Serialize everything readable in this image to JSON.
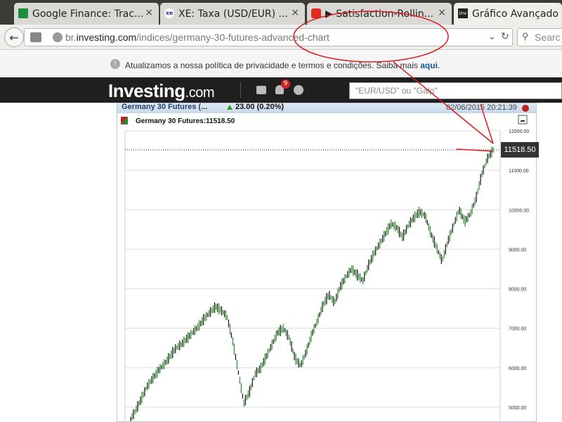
{
  "tabs": [
    {
      "title": "Google Finance: Trac...",
      "close": "×"
    },
    {
      "title": "XE: Taxa (USD/EUR) ...",
      "close": "×"
    },
    {
      "title": "▶ Satisfaction-Rollin...",
      "close": "×"
    },
    {
      "title": "Gráfico Avançado e",
      "close": ""
    }
  ],
  "nav": {
    "url_host_prefix": "br.",
    "url_host_main": "investing.com",
    "url_path": "/indices/germany-30-futures-advanced-chart",
    "search_placeholder": "Searc"
  },
  "notice": {
    "text": "Atualizamos a nossa política de privacidade e termos e condições. Saiba mais",
    "link": "aqui",
    "end": "."
  },
  "header": {
    "logo_main": "Investing",
    "logo_suffix": ".com",
    "notification_count": "9",
    "search_placeholder": "\"EUR/USD\" ou \"Galp\""
  },
  "chart_header": {
    "instrument": "Germany 30 Futures (...",
    "change": "23.00 (0.20%)",
    "datetime": "02/06/2015 20:21:39"
  },
  "chart": {
    "legend": "Germany 30 Futures:11518.50",
    "current_price": "11518.50"
  },
  "chart_data": {
    "type": "line",
    "title": "",
    "xlabel": "",
    "ylabel": "",
    "ylim": [
      4700,
      12200
    ],
    "y_ticks": [
      "12000.00",
      "11000.00",
      "10000.00",
      "9000.00",
      "8000.00",
      "7000.00",
      "6000.00",
      "5000.00"
    ],
    "y_tick_values": [
      12000,
      11000,
      10000,
      9000,
      8000,
      7000,
      6000,
      5000
    ],
    "current_value": 11518.5,
    "series": [
      {
        "values": [
          4700,
          4950,
          5250,
          5550,
          5750,
          5950,
          6100,
          6300,
          6500,
          6600,
          6750,
          6900,
          7050,
          7250,
          7400,
          7550,
          7450,
          7300,
          6700,
          5900,
          5100,
          5400,
          5850,
          6000,
          6300,
          6600,
          6900,
          7000,
          6750,
          6250,
          6050,
          6400,
          6850,
          7200,
          7600,
          7850,
          7650,
          8050,
          8300,
          8500,
          8350,
          8200,
          8600,
          8900,
          9150,
          9400,
          9650,
          9550,
          9300,
          9600,
          9800,
          9950,
          9850,
          9400,
          9050,
          8700,
          9200,
          9600,
          10000,
          9700,
          9900,
          10300,
          10900,
          11300,
          11518.5
        ]
      }
    ]
  }
}
